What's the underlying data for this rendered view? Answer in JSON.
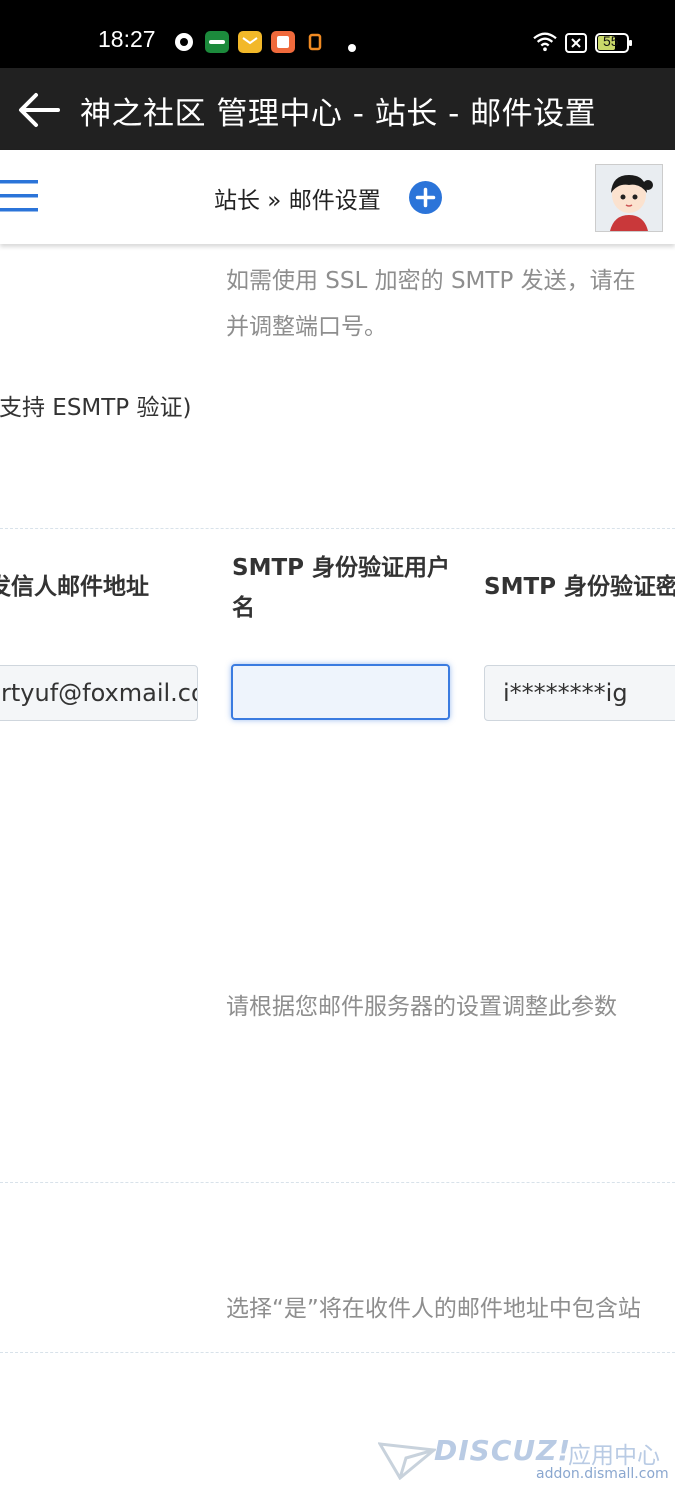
{
  "status_bar": {
    "time": "18:27",
    "battery": "55"
  },
  "app_bar": {
    "title": "神之社区 管理中心 - 站长 - 邮件设置"
  },
  "nav": {
    "breadcrumb": "站长 » 邮件设置"
  },
  "content": {
    "ssl_hint_line1": "如需使用 SSL 加密的 SMTP 发送，请在",
    "ssl_hint_line2": "并调整端口号。",
    "esmtp_text": "(支持 ESMTP 验证)",
    "columns": [
      {
        "label": "发信人邮件地址",
        "value": "rtyuf@foxmail.com"
      },
      {
        "label_line1": "SMTP 身份验证用户",
        "label_line2": "名",
        "value": ""
      },
      {
        "label": "SMTP 身份验证密码",
        "value": "i********ig"
      }
    ],
    "server_hint": "请根据您邮件服务器的设置调整此参数",
    "include_hint": "选择“是”将在收件人的邮件地址中包含站"
  },
  "watermark": {
    "brand": "DISCUZ!",
    "brand_suffix": "应用中心",
    "domain": "addon.dismall.com"
  },
  "colors": {
    "accent": "#2b74d9",
    "appbar": "#212121",
    "hint_text": "#8e8e8e"
  }
}
